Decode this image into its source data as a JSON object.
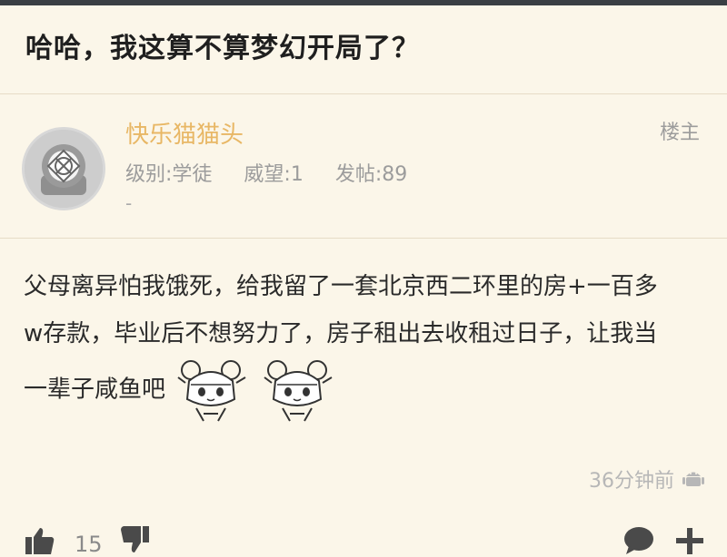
{
  "post": {
    "title": "哈哈，我这算不算梦幻开局了？",
    "author": {
      "name": "快乐猫猫头",
      "role_badge": "楼主",
      "level": "级别:学徒",
      "prestige": "威望:1",
      "posts": "发帖:89",
      "signature": "-"
    },
    "content_line1": "父母离异怕我饿死，给我留了一套北京西二环里的房+一百多",
    "content_line2": "w存款，毕业后不想努力了，房子租出去收租过日子，让我当",
    "content_line3": "一辈子咸鱼吧",
    "time": "36分钟前",
    "like_count": "15"
  },
  "icons": {
    "avatar": "diving-helmet-avatar",
    "sticker": "anime-girl-sticker",
    "device": "android-icon",
    "like": "thumbs-up-icon",
    "dislike": "thumbs-down-icon",
    "reply": "comment-icon",
    "more": "plus-icon"
  },
  "colors": {
    "background": "#fbf6e9",
    "username": "#e8b765",
    "muted": "#9c9c9c"
  }
}
